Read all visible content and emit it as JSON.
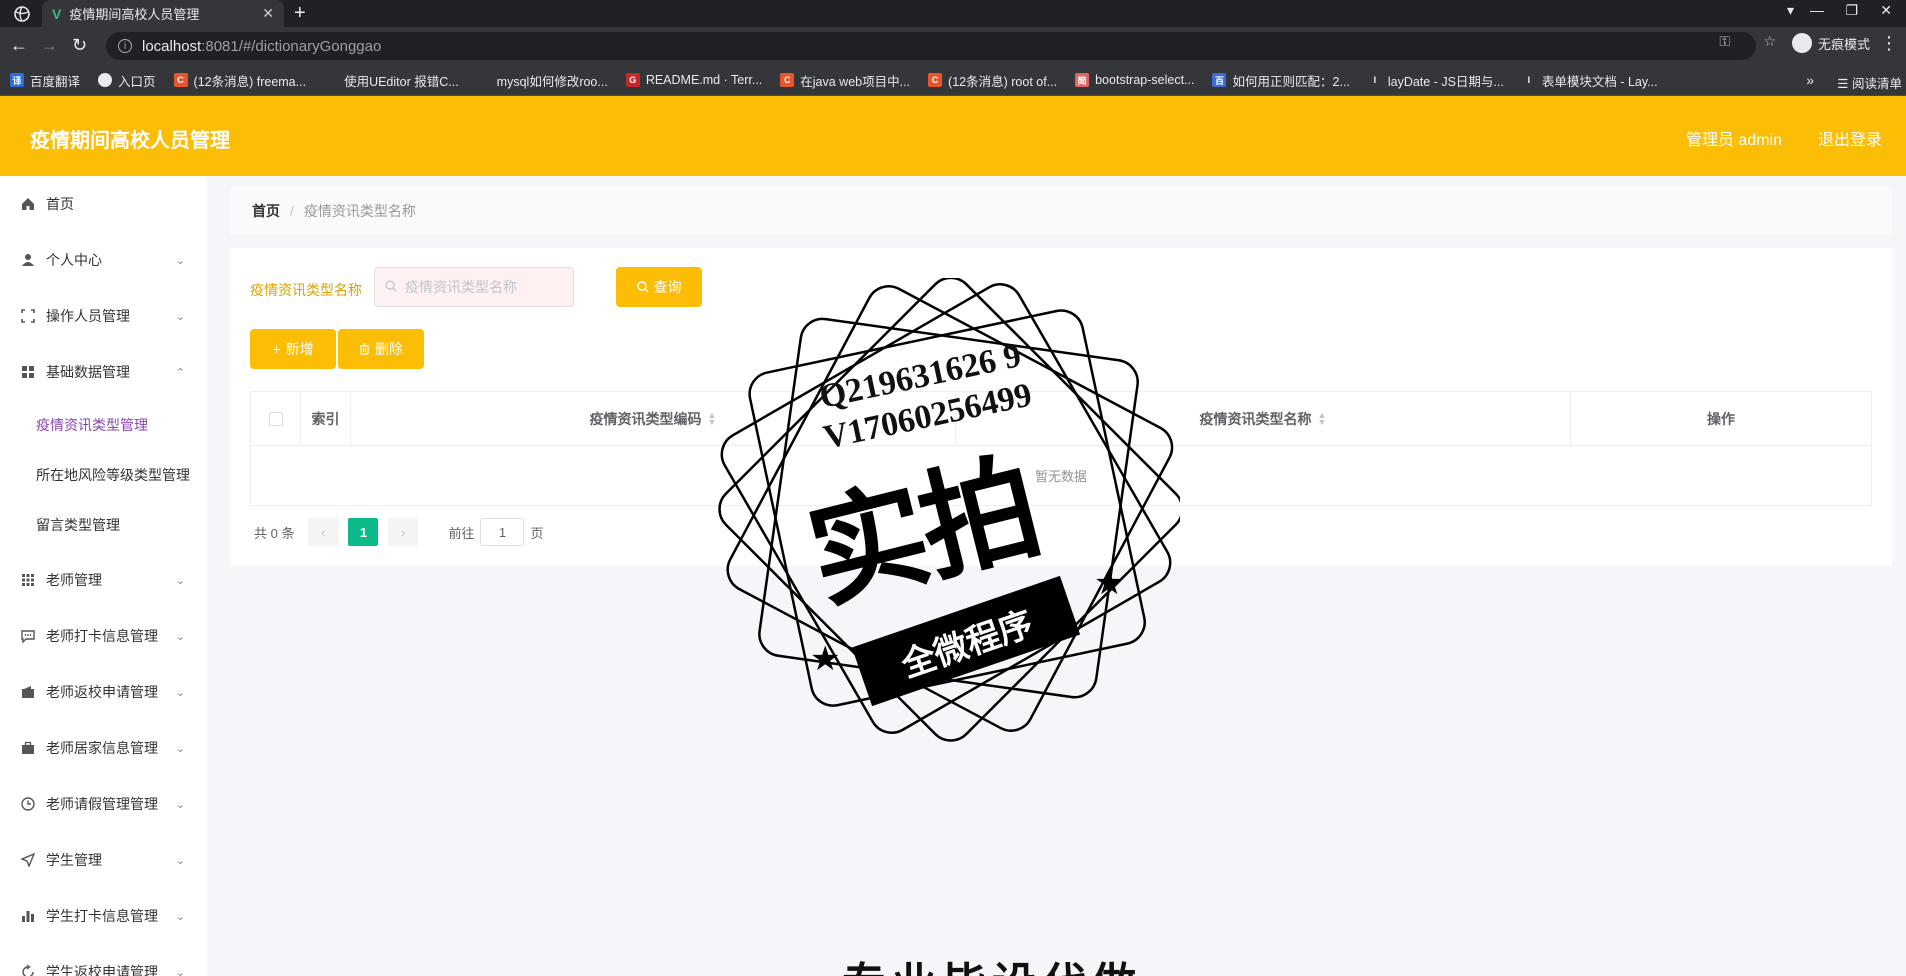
{
  "browser": {
    "tab_title": "疫情期间高校人员管理",
    "url_host": "localhost",
    "url_path": ":8081/#/dictionaryGonggao",
    "incognito_label": "无痕模式",
    "reading_mode_label": "阅读清单",
    "bookmarks": [
      {
        "label": "百度翻译",
        "icon_color": "#2a6fdb",
        "icon_text": "译"
      },
      {
        "label": "入口页",
        "icon_color": "#e8eaed",
        "icon_text": ""
      },
      {
        "label": "(12条消息) freema...",
        "icon_color": "#e8542b",
        "icon_text": "C"
      },
      {
        "label": "使用UEditor 报错C...",
        "icon_color": "#35363a",
        "icon_text": ""
      },
      {
        "label": "mysql如何修改roo...",
        "icon_color": "#35363a",
        "icon_text": ""
      },
      {
        "label": "README.md · Terr...",
        "icon_color": "#c62828",
        "icon_text": "G"
      },
      {
        "label": "在java web项目中...",
        "icon_color": "#e8542b",
        "icon_text": "C"
      },
      {
        "label": "(12条消息) root of...",
        "icon_color": "#e8542b",
        "icon_text": "C"
      },
      {
        "label": "bootstrap-select...",
        "icon_color": "#e06666",
        "icon_text": "简"
      },
      {
        "label": "如何用正则匹配：2...",
        "icon_color": "#3d6bd6",
        "icon_text": "百"
      },
      {
        "label": "layDate - JS日期与...",
        "icon_color": "#35363a",
        "icon_text": "l"
      },
      {
        "label": "表单模块文档 - Lay...",
        "icon_color": "#35363a",
        "icon_text": "l"
      }
    ]
  },
  "header": {
    "app_title": "疫情期间高校人员管理",
    "user_label": "管理员 admin",
    "logout_label": "退出登录",
    "accent_color": "#fcbd05"
  },
  "sidebar": {
    "items": [
      {
        "label": "首页",
        "icon": "home-icon",
        "chevron": ""
      },
      {
        "label": "个人中心",
        "icon": "user-icon",
        "chevron": "⌄"
      },
      {
        "label": "操作人员管理",
        "icon": "frame-icon",
        "chevron": "⌄"
      },
      {
        "label": "基础数据管理",
        "icon": "grid-icon",
        "chevron": "⌃"
      },
      {
        "label": "老师管理",
        "icon": "apps-icon",
        "chevron": "⌄"
      },
      {
        "label": "老师打卡信息管理",
        "icon": "chat-icon",
        "chevron": "⌄"
      },
      {
        "label": "老师返校申请管理",
        "icon": "wallet-icon",
        "chevron": "⌄"
      },
      {
        "label": "老师居家信息管理",
        "icon": "briefcase-icon",
        "chevron": "⌄"
      },
      {
        "label": "老师请假管理管理",
        "icon": "clock-icon",
        "chevron": "⌄"
      },
      {
        "label": "学生管理",
        "icon": "send-icon",
        "chevron": "⌄"
      },
      {
        "label": "学生打卡信息管理",
        "icon": "bar-chart-icon",
        "chevron": "⌄"
      },
      {
        "label": "学生返校申请管理",
        "icon": "refresh-icon",
        "chevron": "⌄"
      }
    ],
    "sub_items": [
      {
        "label": "疫情资讯类型管理",
        "active": true
      },
      {
        "label": "所在地风险等级类型管理",
        "active": false
      },
      {
        "label": "留言类型管理",
        "active": false
      }
    ]
  },
  "breadcrumb": {
    "home": "首页",
    "separator": "/",
    "current": "疫情资讯类型名称"
  },
  "search": {
    "label": "疫情资讯类型名称",
    "placeholder": "疫情资讯类型名称",
    "value": "",
    "button_label": "查询"
  },
  "actions": {
    "add_label": "新增",
    "delete_label": "删除"
  },
  "table": {
    "columns": [
      "索引",
      "疫情资讯类型编码",
      "疫情资讯类型名称",
      "操作"
    ],
    "empty_text": "暂无数据",
    "rows": []
  },
  "pagination": {
    "total_text": "共 0 条",
    "current_page": "1",
    "goto_label": "前往",
    "goto_value": "1",
    "page_suffix": "页"
  },
  "watermark": {
    "line1": "Q219631626 9",
    "line2": "V17060256499",
    "big_text": "实拍",
    "ribbon_text": "全微程序",
    "bottom_text": "专业毕设代做"
  }
}
